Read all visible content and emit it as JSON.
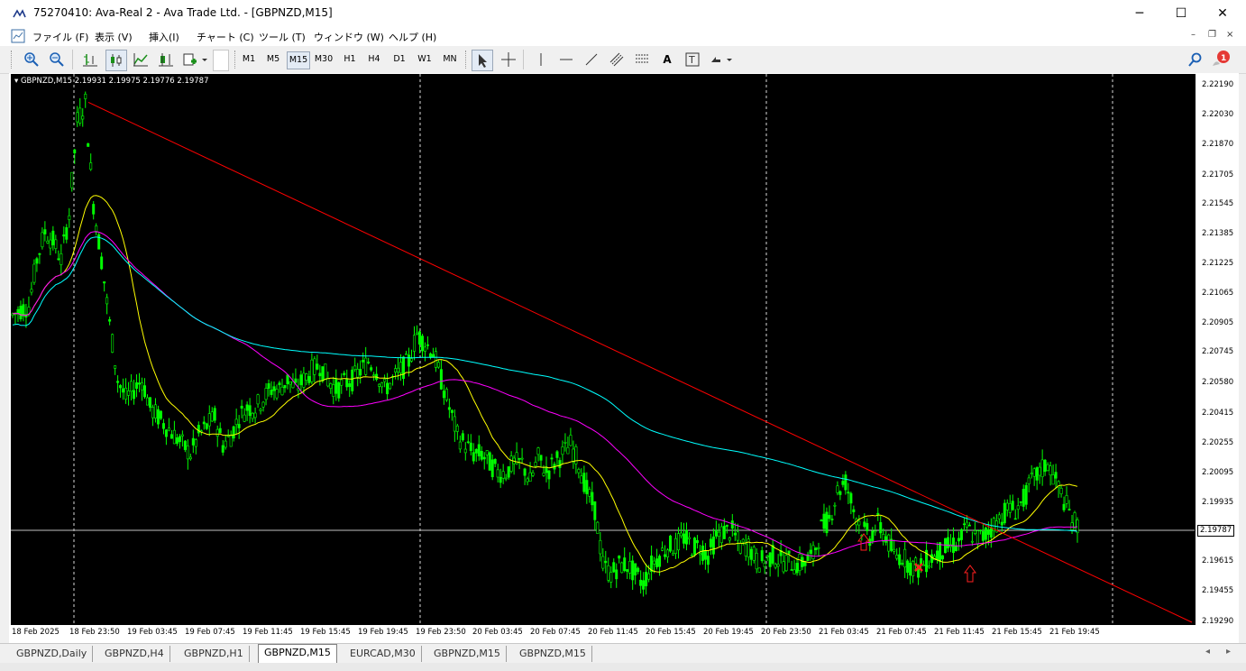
{
  "window": {
    "title": "75270410: Ava-Real 2 - Ava Trade Ltd. - [GBPNZD,M15]",
    "minimize_glyph": "─",
    "maximize_glyph": "☐",
    "close_glyph": "✕"
  },
  "menu": {
    "items": [
      "ファイル (F)",
      "表示 (V)",
      "挿入(I)",
      "チャート (C)",
      "ツール (T)",
      "ウィンドウ (W)",
      "ヘルプ (H)"
    ],
    "mdi_minimize": "–",
    "mdi_restore": "❐",
    "mdi_close": "×"
  },
  "toolbar": {
    "timeframes": [
      "M1",
      "M5",
      "M15",
      "M30",
      "H1",
      "H4",
      "D1",
      "W1",
      "MN"
    ],
    "active_timeframe": "M15",
    "icons": [
      "zoom-in-icon",
      "zoom-out-icon",
      "bar-chart-icon",
      "candlestick-icon",
      "line-chart-icon",
      "auto-scroll-icon",
      "add-indicator-icon",
      "cursor-icon",
      "crosshair-icon",
      "vertical-line-icon",
      "horizontal-line-icon",
      "trendline-icon",
      "channel-icon",
      "fibonacci-icon",
      "text-icon",
      "label-icon",
      "arrows-icon",
      "search-icon",
      "notification-icon"
    ],
    "notification_count": "1"
  },
  "chart": {
    "header": "GBPNZD,M15  2.19931 2.19975 2.19776 2.19787",
    "current_price": "2.19787",
    "background": "#000000",
    "candle_color": "#00ff00",
    "trendline_color": "#ff0000",
    "ma_fast_color": "#ffff00",
    "ma_mid_color": "#ff00ff",
    "ma_slow_color": "#00ffff"
  },
  "chart_data": {
    "type": "candlestick",
    "symbol": "GBPNZD",
    "timeframe": "M15",
    "y_ticks": [
      "2.22190",
      "2.22030",
      "2.21870",
      "2.21705",
      "2.21545",
      "2.21385",
      "2.21225",
      "2.21065",
      "2.20905",
      "2.20745",
      "2.20580",
      "2.20415",
      "2.20255",
      "2.20095",
      "2.19935",
      "2.19775",
      "2.19615",
      "2.19455",
      "2.19290"
    ],
    "ylim": [
      2.1929,
      2.2219
    ],
    "x_ticks": [
      "18 Feb 2025",
      "18 Feb 23:50",
      "19 Feb 03:45",
      "19 Feb 07:45",
      "19 Feb 11:45",
      "19 Feb 15:45",
      "19 Feb 19:45",
      "19 Feb 23:50",
      "20 Feb 03:45",
      "20 Feb 07:45",
      "20 Feb 11:45",
      "20 Feb 15:45",
      "20 Feb 19:45",
      "20 Feb 23:50",
      "21 Feb 03:45",
      "21 Feb 07:45",
      "21 Feb 11:45",
      "21 Feb 15:45",
      "21 Feb 19:45"
    ],
    "close_path": [
      2.2095,
      2.2098,
      2.21,
      2.2125,
      2.214,
      2.2135,
      2.2125,
      2.215,
      2.22,
      2.221,
      2.2155,
      2.2125,
      2.209,
      2.206,
      2.205,
      2.2055,
      2.206,
      2.2045,
      2.204,
      2.2035,
      2.203,
      2.2025,
      2.202,
      2.203,
      2.2035,
      2.204,
      2.2025,
      2.203,
      2.204,
      2.2045,
      2.2045,
      2.205,
      2.2055,
      2.2055,
      2.206,
      2.2055,
      2.206,
      2.2065,
      2.2068,
      2.206,
      2.2055,
      2.2058,
      2.206,
      2.2065,
      2.207,
      2.2065,
      2.2055,
      2.206,
      2.2065,
      2.207,
      2.2085,
      2.208,
      2.2075,
      2.206,
      2.2045,
      2.203,
      2.2025,
      2.202,
      2.202,
      2.2015,
      2.201,
      2.201,
      2.2015,
      2.2015,
      2.2005,
      2.2018,
      2.201,
      2.2015,
      2.202,
      2.2025,
      2.2015,
      2.2,
      2.199,
      2.196,
      2.1955,
      2.196,
      2.196,
      2.1955,
      2.195,
      2.196,
      2.1965,
      2.197,
      2.197,
      2.1975,
      2.197,
      2.197,
      2.1965,
      2.1975,
      2.1978,
      2.1978,
      2.197,
      2.197,
      2.1962,
      2.1962,
      2.1965,
      2.1962,
      2.1962,
      2.196,
      2.1962,
      2.1965,
      2.198,
      2.1985,
      2.2,
      2.2005,
      2.199,
      2.198,
      2.1975,
      2.1982,
      2.1975,
      2.1965,
      2.1965,
      2.196,
      2.1958,
      2.1962,
      2.1965,
      2.1968,
      2.197,
      2.1972,
      2.198,
      2.1975,
      2.1975,
      2.198,
      2.1985,
      2.199,
      2.199,
      2.1995,
      2.2005,
      2.201,
      2.2015,
      2.2005,
      2.1995,
      2.1985,
      2.1979
    ],
    "trendline": {
      "from": [
        "18 Feb 23:50",
        2.221
      ],
      "to": [
        "21 Feb 23:50",
        2.1929
      ]
    },
    "series": [
      {
        "name": "",
        "type": "ma-fast"
      },
      {
        "name": "",
        "type": "ma-mid"
      },
      {
        "name": "",
        "type": "ma-slow"
      }
    ],
    "grid": "vertical session separators"
  },
  "tabs": [
    "GBPNZD,Daily",
    "GBPNZD,H4",
    "GBPNZD,H1",
    "GBPNZD,M15",
    "EURCAD,M30",
    "GBPNZD,M15",
    "GBPNZD,M15"
  ],
  "active_tab": "GBPNZD,M15",
  "tab_scroll": {
    "left": "◂",
    "right": "▸"
  }
}
